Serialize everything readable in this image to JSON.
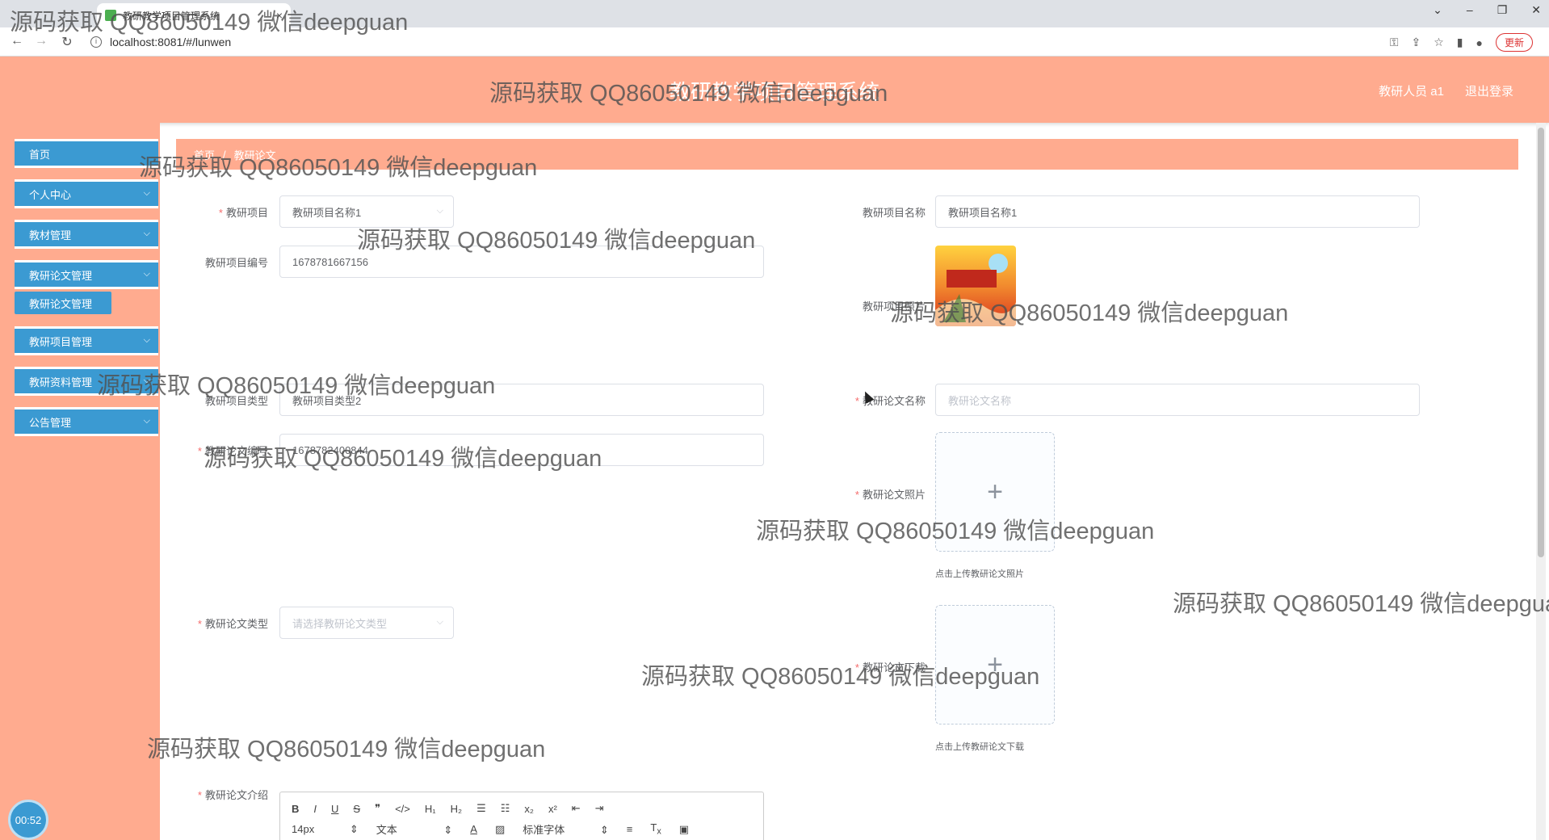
{
  "browser": {
    "tab_title": "教研教学项目管理系统",
    "url": "localhost:8081/#/lunwen",
    "update_label": "更新"
  },
  "header": {
    "title": "教研教学项目管理系统",
    "user_label": "教研人员 a1",
    "logout_label": "退出登录"
  },
  "sidebar": {
    "items": [
      {
        "label": "首页"
      },
      {
        "label": "个人中心"
      },
      {
        "label": "教材管理"
      },
      {
        "label": "教研论文管理"
      },
      {
        "label": "教研论文管理"
      },
      {
        "label": "教研项目管理"
      },
      {
        "label": "教研资料管理"
      },
      {
        "label": "公告管理"
      }
    ],
    "timer": "00:52"
  },
  "breadcrumb": {
    "home": "首页",
    "current": "教研论文"
  },
  "form": {
    "project_label": "教研项目",
    "project_value": "教研项目名称1",
    "project_name_label": "教研项目名称",
    "project_name_value": "教研项目名称1",
    "project_no_label": "教研项目编号",
    "project_no_value": "1678781667156",
    "project_photo_label": "教研项目照片",
    "project_type_label": "教研项目类型",
    "project_type_value": "教研项目类型2",
    "paper_name_label": "教研论文名称",
    "paper_name_placeholder": "教研论文名称",
    "paper_no_label": "教研论文编号",
    "paper_no_value": "1678782400844",
    "paper_photo_label": "教研论文照片",
    "paper_photo_hint": "点击上传教研论文照片",
    "paper_type_label": "教研论文类型",
    "paper_type_placeholder": "请选择教研论文类型",
    "paper_download_label": "教研论文下载",
    "paper_download_hint": "点击上传教研论文下载",
    "paper_intro_label": "教研论文介绍"
  },
  "editor": {
    "row1": [
      "B",
      "I",
      "U",
      "S",
      "❞",
      "</>",
      "H₁",
      "H₂",
      "☰",
      "☷",
      "x₂",
      "x²",
      "⇤",
      "⇥"
    ],
    "font_size": "14px",
    "text_style": "文本",
    "font_family": "标准字体"
  },
  "watermark_text": "源码获取 QQ86050149 微信deepguan"
}
